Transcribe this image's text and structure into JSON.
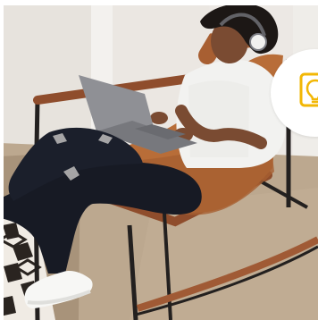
{
  "image": {
    "subject": "woman-with-headphones-working-on-laptop-in-leather-rocking-chair"
  },
  "badge": {
    "icon": "lightbulb-idea-icon",
    "icon_color": "#f2b705",
    "background": "#ffffff"
  },
  "colors": {
    "wall": "#ece8e4",
    "floor": "#b9a58c",
    "chair_leather": "#b46a36",
    "chair_frame": "#24201f",
    "shirt": "#f3f3f1",
    "jeans": "#161a24",
    "skin": "#7a4b32",
    "laptop": "#8e8f93",
    "shoes": "#f6f6f4",
    "rug_dark": "#2a2420",
    "rug_light": "#efe9e2"
  }
}
